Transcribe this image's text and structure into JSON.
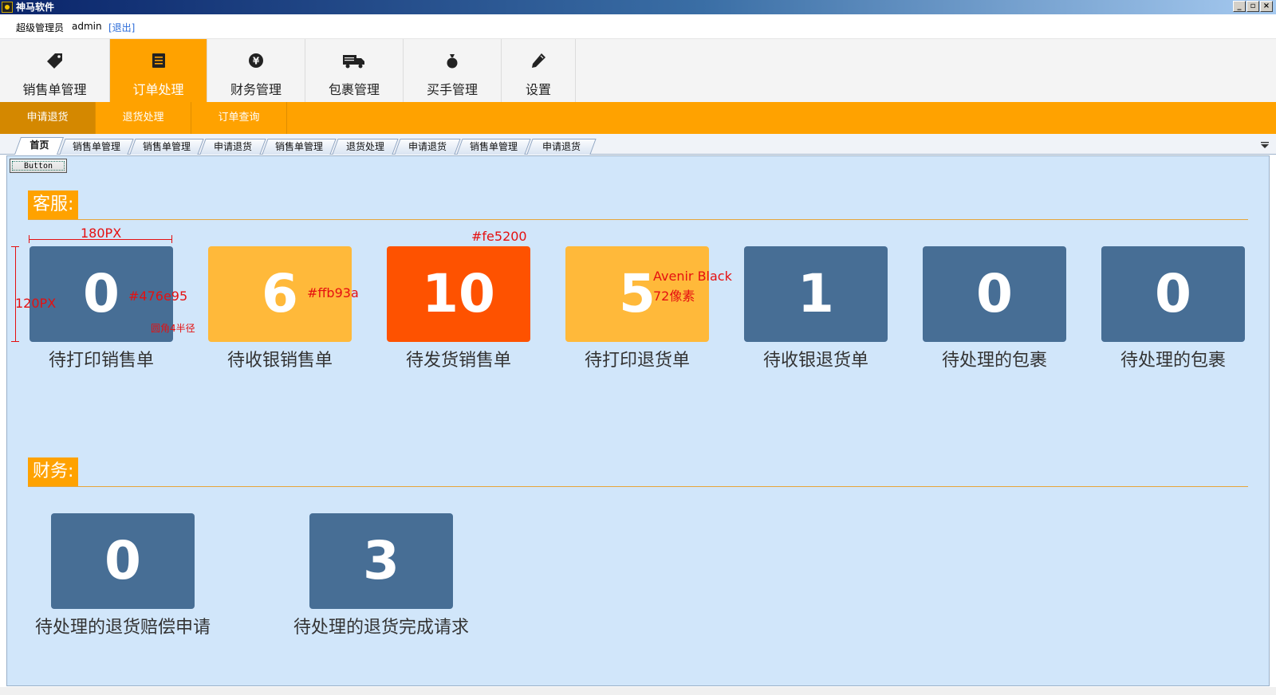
{
  "window": {
    "title": "神马软件",
    "controls": [
      "_",
      "▫",
      "×"
    ]
  },
  "userbar": {
    "role": "超级管理员",
    "username": "admin",
    "logout": "[退出]"
  },
  "main_nav": [
    {
      "label": "销售单管理",
      "icon": "tag-icon",
      "active": false
    },
    {
      "label": "订单处理",
      "icon": "list-icon",
      "active": true
    },
    {
      "label": "财务管理",
      "icon": "yen-icon",
      "active": false
    },
    {
      "label": "包裹管理",
      "icon": "truck-icon",
      "active": false
    },
    {
      "label": "买手管理",
      "icon": "money-bag-icon",
      "active": false
    },
    {
      "label": "设置",
      "icon": "pencil-icon",
      "active": false
    }
  ],
  "sub_nav": [
    {
      "label": "申请退货",
      "active": true
    },
    {
      "label": "退货处理",
      "active": false
    },
    {
      "label": "订单查询",
      "active": false
    }
  ],
  "tabs": [
    {
      "label": "首页",
      "active": true
    },
    {
      "label": "销售单管理",
      "active": false
    },
    {
      "label": "销售单管理",
      "active": false
    },
    {
      "label": "申请退货",
      "active": false
    },
    {
      "label": "销售单管理",
      "active": false
    },
    {
      "label": "退货处理",
      "active": false
    },
    {
      "label": "申请退货",
      "active": false
    },
    {
      "label": "销售单管理",
      "active": false
    },
    {
      "label": "申请退货",
      "active": false
    }
  ],
  "button_label": "Button",
  "sections": {
    "customer_service": {
      "title": "客服:",
      "cards": [
        {
          "value": "0",
          "label": "待打印销售单",
          "color": "#476e95"
        },
        {
          "value": "6",
          "label": "待收银销售单",
          "color": "#ffb93a"
        },
        {
          "value": "10",
          "label": "待发货销售单",
          "color": "#fe5200"
        },
        {
          "value": "5",
          "label": "待打印退货单",
          "color": "#ffb93a"
        },
        {
          "value": "1",
          "label": "待收银退货单",
          "color": "#476e95"
        },
        {
          "value": "0",
          "label": "待处理的包裹",
          "color": "#476e95"
        },
        {
          "value": "0",
          "label": "待处理的包裹",
          "color": "#476e95"
        }
      ]
    },
    "finance": {
      "title": "财务:",
      "cards": [
        {
          "value": "0",
          "label": "待处理的退货赔偿申请",
          "color": "#476e95"
        },
        {
          "value": "3",
          "label": "待处理的退货完成请求",
          "color": "#476e95"
        }
      ]
    }
  },
  "annotations": {
    "width": "180PX",
    "height": "120PX",
    "color_blue": "#476e95",
    "radius": "圆角4半径",
    "color_yellow": "#ffb93a",
    "color_red": "#fe5200",
    "font_name": "Avenir Black",
    "font_size": "72像素"
  }
}
